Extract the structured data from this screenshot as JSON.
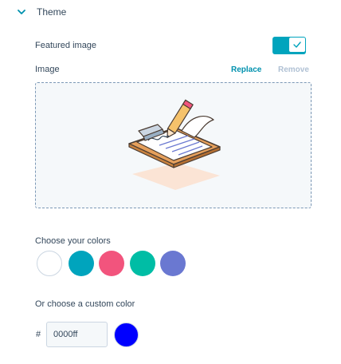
{
  "section": {
    "title": "Theme",
    "icon": "chevron-down-icon"
  },
  "featured_image": {
    "label": "Featured image",
    "toggle_on": true,
    "toggle_color": "#00a4bd"
  },
  "image": {
    "label": "Image",
    "replace_label": "Replace",
    "remove_label": "Remove",
    "replace_color": "#0091ae",
    "remove_color": "#b0c1d4",
    "illustration": "clipboard-pencil-illustration"
  },
  "colors": {
    "label": "Choose your colors",
    "swatches": [
      {
        "name": "white",
        "hex": "#ffffff"
      },
      {
        "name": "teal",
        "hex": "#00a4bd"
      },
      {
        "name": "pink",
        "hex": "#f2547d"
      },
      {
        "name": "green",
        "hex": "#00bda5"
      },
      {
        "name": "purple",
        "hex": "#6a78d1"
      }
    ]
  },
  "custom_color": {
    "label": "Or choose a custom color",
    "hash_symbol": "#",
    "value": "0000ff",
    "preview_hex": "#0000ff"
  }
}
